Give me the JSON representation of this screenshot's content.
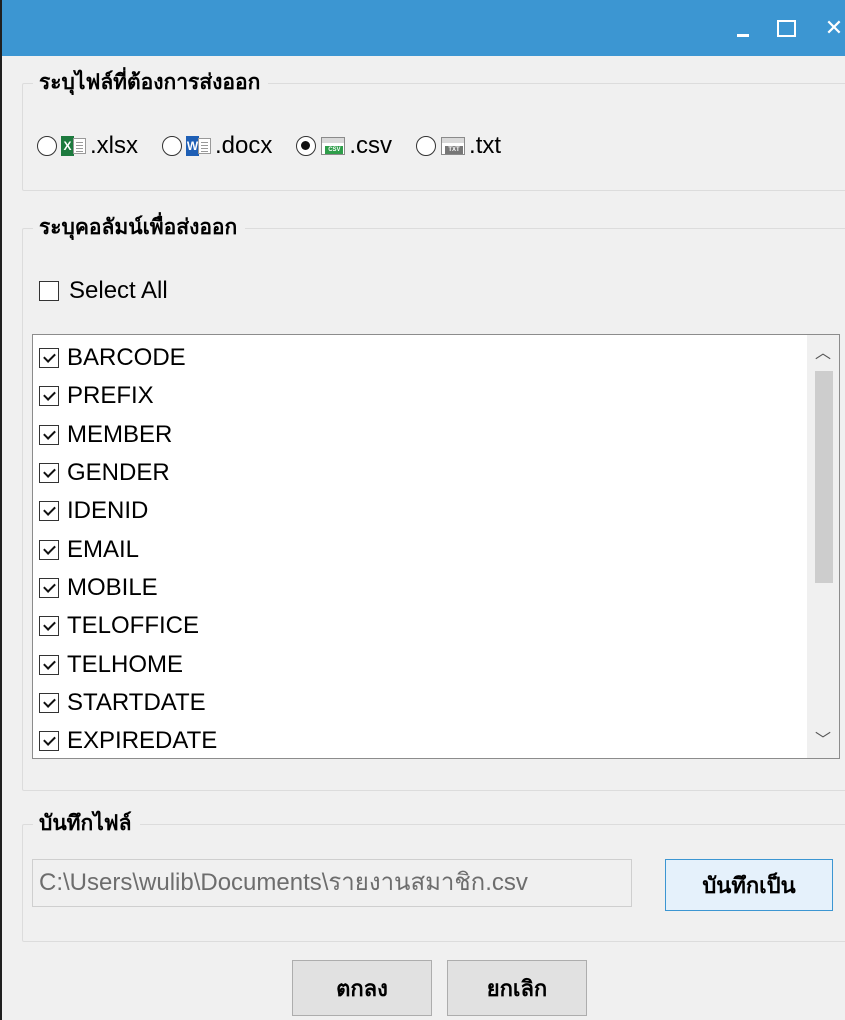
{
  "window": {
    "minimize_label": "_",
    "maximize_label": "☐",
    "close_label": "✕"
  },
  "file_type_group": {
    "title": "ระบุไฟล์ที่ต้องการส่งออก",
    "options": [
      {
        "label": ".xlsx",
        "icon": "excel-file-icon",
        "selected": false
      },
      {
        "label": ".docx",
        "icon": "word-file-icon",
        "selected": false
      },
      {
        "label": ".csv",
        "icon": "csv-file-icon",
        "selected": true
      },
      {
        "label": ".txt",
        "icon": "txt-file-icon",
        "selected": false
      }
    ]
  },
  "columns_group": {
    "title": "ระบุคอลัมน์เพื่อส่งออก",
    "select_all_label": "Select All",
    "select_all_checked": false,
    "items": [
      {
        "label": "BARCODE",
        "checked": true
      },
      {
        "label": "PREFIX",
        "checked": true
      },
      {
        "label": "MEMBER",
        "checked": true
      },
      {
        "label": "GENDER",
        "checked": true
      },
      {
        "label": "IDENID",
        "checked": true
      },
      {
        "label": "EMAIL",
        "checked": true
      },
      {
        "label": "MOBILE",
        "checked": true
      },
      {
        "label": "TELOFFICE",
        "checked": true
      },
      {
        "label": "TELHOME",
        "checked": true
      },
      {
        "label": "STARTDATE",
        "checked": true
      },
      {
        "label": "EXPIREDATE",
        "checked": true
      }
    ],
    "scroll_up_icon": "chevron-up-icon",
    "scroll_down_icon": "chevron-down-icon"
  },
  "save_group": {
    "title": "บันทึกไฟล์",
    "path_value": "C:\\Users\\wulib\\Documents\\รายงานสมาชิก.csv",
    "save_as_label": "บันทึกเป็น"
  },
  "footer": {
    "ok_label": "ตกลง",
    "cancel_label": "ยกเลิก"
  },
  "colors": {
    "titlebar": "#3c96d2",
    "window_bg": "#f0f0f0"
  }
}
